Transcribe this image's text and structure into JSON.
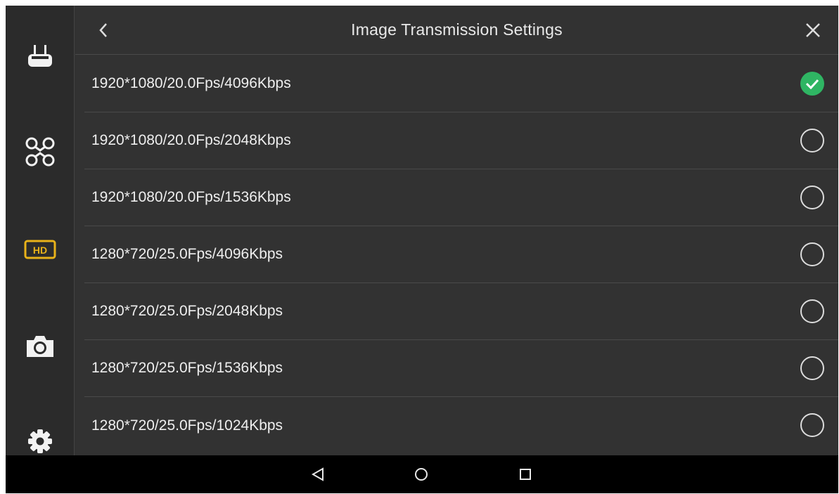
{
  "header": {
    "title": "Image Transmission Settings"
  },
  "sidebar": {
    "items": [
      {
        "icon": "remote-controller-icon"
      },
      {
        "icon": "drone-icon"
      },
      {
        "icon": "hd-icon",
        "label": "HD",
        "active": true,
        "accent": "#e8b21a"
      },
      {
        "icon": "camera-icon"
      },
      {
        "icon": "gear-icon"
      }
    ]
  },
  "options": [
    {
      "label": "1920*1080/20.0Fps/4096Kbps",
      "selected": true
    },
    {
      "label": "1920*1080/20.0Fps/2048Kbps",
      "selected": false
    },
    {
      "label": "1920*1080/20.0Fps/1536Kbps",
      "selected": false
    },
    {
      "label": "1280*720/25.0Fps/4096Kbps",
      "selected": false
    },
    {
      "label": "1280*720/25.0Fps/2048Kbps",
      "selected": false
    },
    {
      "label": "1280*720/25.0Fps/1536Kbps",
      "selected": false
    },
    {
      "label": "1280*720/25.0Fps/1024Kbps",
      "selected": false
    }
  ],
  "navbar": {
    "buttons": [
      "back-triangle-icon",
      "home-circle-icon",
      "recents-square-icon"
    ]
  },
  "colors": {
    "selected": "#2fb563",
    "accent": "#e8b21a",
    "background": "#323232"
  }
}
